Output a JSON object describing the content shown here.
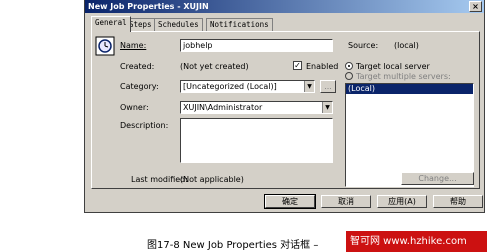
{
  "window": {
    "title": "New Job Properties - XUJIN",
    "close_glyph": "×"
  },
  "tabs": [
    "General",
    "Steps",
    "Schedules",
    "Notifications"
  ],
  "general": {
    "name_label": "Name:",
    "name_value": "jobhelp",
    "source_label": "Source:",
    "source_value": "(local)",
    "created_label": "Created:",
    "created_value": "(Not yet created)",
    "enabled_label": "Enabled",
    "enabled_checked": true,
    "category_label": "Category:",
    "category_value": "[Uncategorized (Local)]",
    "browse_label": "...",
    "owner_label": "Owner:",
    "owner_value": "XUJIN\\Administrator",
    "description_label": "Description:",
    "description_value": "",
    "target_local_label": "Target local server",
    "target_multiple_label": "Target multiple servers:",
    "servers_list": [
      "(Local)"
    ],
    "last_modified_label": "Last modified:",
    "last_modified_value": "(Not applicable)",
    "change_label": "Change..."
  },
  "footer_buttons": {
    "ok": "确定",
    "cancel": "取消",
    "apply": "应用(A)",
    "help": "帮助"
  },
  "caption": "图17-8  New Job Properties 对话框 –",
  "watermark": "智可网 www.hzhike.com"
}
